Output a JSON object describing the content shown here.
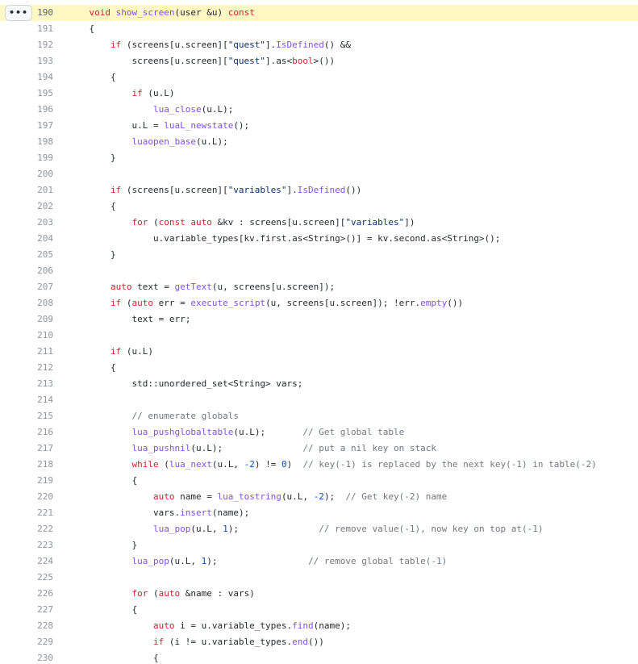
{
  "toolbar": {
    "expand_label": "•••"
  },
  "highlight_color": "#fff8c5",
  "colors": {
    "keyword": "#cf222e",
    "function": "#8250df",
    "string": "#0a3069",
    "comment": "#6e7781",
    "number": "#0550ae",
    "plain": "#24292f",
    "line_number": "#8c959f"
  },
  "lines": [
    {
      "num": "190",
      "highlighted": true,
      "tokens": [
        [
          "pl",
          "    "
        ],
        [
          "kw",
          "void"
        ],
        [
          "pl",
          " "
        ],
        [
          "fn",
          "show_screen"
        ],
        [
          "pl",
          "(user &u) "
        ],
        [
          "kw",
          "const"
        ]
      ]
    },
    {
      "num": "191",
      "tokens": [
        [
          "pl",
          "    {"
        ]
      ]
    },
    {
      "num": "192",
      "tokens": [
        [
          "pl",
          "        "
        ],
        [
          "kw",
          "if"
        ],
        [
          "pl",
          " (screens[u.screen]["
        ],
        [
          "str",
          "\"quest\""
        ],
        [
          "pl",
          "]."
        ],
        [
          "fn",
          "IsDefined"
        ],
        [
          "pl",
          "() &&"
        ]
      ]
    },
    {
      "num": "193",
      "tokens": [
        [
          "pl",
          "            screens[u.screen]["
        ],
        [
          "str",
          "\"quest\""
        ],
        [
          "pl",
          "].as<"
        ],
        [
          "kw",
          "bool"
        ],
        [
          "pl",
          ">())"
        ]
      ]
    },
    {
      "num": "194",
      "tokens": [
        [
          "pl",
          "        {"
        ]
      ]
    },
    {
      "num": "195",
      "tokens": [
        [
          "pl",
          "            "
        ],
        [
          "kw",
          "if"
        ],
        [
          "pl",
          " (u.L)"
        ]
      ]
    },
    {
      "num": "196",
      "tokens": [
        [
          "pl",
          "                "
        ],
        [
          "fn",
          "lua_close"
        ],
        [
          "pl",
          "(u.L);"
        ]
      ]
    },
    {
      "num": "197",
      "tokens": [
        [
          "pl",
          "            u.L = "
        ],
        [
          "fn",
          "luaL_newstate"
        ],
        [
          "pl",
          "();"
        ]
      ]
    },
    {
      "num": "198",
      "tokens": [
        [
          "pl",
          "            "
        ],
        [
          "fn",
          "luaopen_base"
        ],
        [
          "pl",
          "(u.L);"
        ]
      ]
    },
    {
      "num": "199",
      "tokens": [
        [
          "pl",
          "        }"
        ]
      ]
    },
    {
      "num": "200",
      "tokens": [
        [
          "pl",
          ""
        ]
      ]
    },
    {
      "num": "201",
      "tokens": [
        [
          "pl",
          "        "
        ],
        [
          "kw",
          "if"
        ],
        [
          "pl",
          " (screens[u.screen]["
        ],
        [
          "str",
          "\"variables\""
        ],
        [
          "pl",
          "]."
        ],
        [
          "fn",
          "IsDefined"
        ],
        [
          "pl",
          "())"
        ]
      ]
    },
    {
      "num": "202",
      "tokens": [
        [
          "pl",
          "        {"
        ]
      ]
    },
    {
      "num": "203",
      "tokens": [
        [
          "pl",
          "            "
        ],
        [
          "kw",
          "for"
        ],
        [
          "pl",
          " ("
        ],
        [
          "kw",
          "const"
        ],
        [
          "pl",
          " "
        ],
        [
          "kw",
          "auto"
        ],
        [
          "pl",
          " &kv : screens[u.screen]["
        ],
        [
          "str",
          "\"variables\""
        ],
        [
          "pl",
          "])"
        ]
      ]
    },
    {
      "num": "204",
      "tokens": [
        [
          "pl",
          "                u.variable_types[kv.first.as<String>()] = kv.second.as<String>();"
        ]
      ]
    },
    {
      "num": "205",
      "tokens": [
        [
          "pl",
          "        }"
        ]
      ]
    },
    {
      "num": "206",
      "tokens": [
        [
          "pl",
          ""
        ]
      ]
    },
    {
      "num": "207",
      "tokens": [
        [
          "pl",
          "        "
        ],
        [
          "kw",
          "auto"
        ],
        [
          "pl",
          " text = "
        ],
        [
          "fn",
          "getText"
        ],
        [
          "pl",
          "(u, screens[u.screen]);"
        ]
      ]
    },
    {
      "num": "208",
      "tokens": [
        [
          "pl",
          "        "
        ],
        [
          "kw",
          "if"
        ],
        [
          "pl",
          " ("
        ],
        [
          "kw",
          "auto"
        ],
        [
          "pl",
          " err = "
        ],
        [
          "fn",
          "execute_script"
        ],
        [
          "pl",
          "(u, screens[u.screen]); !err."
        ],
        [
          "fn",
          "empty"
        ],
        [
          "pl",
          "())"
        ]
      ]
    },
    {
      "num": "209",
      "tokens": [
        [
          "pl",
          "            text = err;"
        ]
      ]
    },
    {
      "num": "210",
      "tokens": [
        [
          "pl",
          ""
        ]
      ]
    },
    {
      "num": "211",
      "tokens": [
        [
          "pl",
          "        "
        ],
        [
          "kw",
          "if"
        ],
        [
          "pl",
          " (u.L)"
        ]
      ]
    },
    {
      "num": "212",
      "tokens": [
        [
          "pl",
          "        {"
        ]
      ]
    },
    {
      "num": "213",
      "tokens": [
        [
          "pl",
          "            std::unordered_set<String> vars;"
        ]
      ]
    },
    {
      "num": "214",
      "tokens": [
        [
          "pl",
          ""
        ]
      ]
    },
    {
      "num": "215",
      "tokens": [
        [
          "pl",
          "            "
        ],
        [
          "cm",
          "// enumerate globals"
        ]
      ]
    },
    {
      "num": "216",
      "tokens": [
        [
          "pl",
          "            "
        ],
        [
          "fn",
          "lua_pushglobaltable"
        ],
        [
          "pl",
          "(u.L);       "
        ],
        [
          "cm",
          "// Get global table"
        ]
      ]
    },
    {
      "num": "217",
      "tokens": [
        [
          "pl",
          "            "
        ],
        [
          "fn",
          "lua_pushnil"
        ],
        [
          "pl",
          "(u.L);               "
        ],
        [
          "cm",
          "// put a nil key on stack"
        ]
      ]
    },
    {
      "num": "218",
      "tokens": [
        [
          "pl",
          "            "
        ],
        [
          "kw",
          "while"
        ],
        [
          "pl",
          " ("
        ],
        [
          "fn",
          "lua_next"
        ],
        [
          "pl",
          "(u.L, "
        ],
        [
          "num",
          "-2"
        ],
        [
          "pl",
          ") != "
        ],
        [
          "num",
          "0"
        ],
        [
          "pl",
          ")  "
        ],
        [
          "cm",
          "// key(-1) is replaced by the next key(-1) in table(-2)"
        ]
      ]
    },
    {
      "num": "219",
      "tokens": [
        [
          "pl",
          "            {"
        ]
      ]
    },
    {
      "num": "220",
      "tokens": [
        [
          "pl",
          "                "
        ],
        [
          "kw",
          "auto"
        ],
        [
          "pl",
          " name = "
        ],
        [
          "fn",
          "lua_tostring"
        ],
        [
          "pl",
          "(u.L, "
        ],
        [
          "num",
          "-2"
        ],
        [
          "pl",
          ");  "
        ],
        [
          "cm",
          "// Get key(-2) name"
        ]
      ]
    },
    {
      "num": "221",
      "tokens": [
        [
          "pl",
          "                vars."
        ],
        [
          "fn",
          "insert"
        ],
        [
          "pl",
          "(name);"
        ]
      ]
    },
    {
      "num": "222",
      "tokens": [
        [
          "pl",
          "                "
        ],
        [
          "fn",
          "lua_pop"
        ],
        [
          "pl",
          "(u.L, "
        ],
        [
          "num",
          "1"
        ],
        [
          "pl",
          ");               "
        ],
        [
          "cm",
          "// remove value(-1), now key on top at(-1)"
        ]
      ]
    },
    {
      "num": "223",
      "tokens": [
        [
          "pl",
          "            }"
        ]
      ]
    },
    {
      "num": "224",
      "tokens": [
        [
          "pl",
          "            "
        ],
        [
          "fn",
          "lua_pop"
        ],
        [
          "pl",
          "(u.L, "
        ],
        [
          "num",
          "1"
        ],
        [
          "pl",
          ");                 "
        ],
        [
          "cm",
          "// remove global table(-1)"
        ]
      ]
    },
    {
      "num": "225",
      "tokens": [
        [
          "pl",
          ""
        ]
      ]
    },
    {
      "num": "226",
      "tokens": [
        [
          "pl",
          "            "
        ],
        [
          "kw",
          "for"
        ],
        [
          "pl",
          " ("
        ],
        [
          "kw",
          "auto"
        ],
        [
          "pl",
          " &name : vars)"
        ]
      ]
    },
    {
      "num": "227",
      "tokens": [
        [
          "pl",
          "            {"
        ]
      ]
    },
    {
      "num": "228",
      "tokens": [
        [
          "pl",
          "                "
        ],
        [
          "kw",
          "auto"
        ],
        [
          "pl",
          " i = u.variable_types."
        ],
        [
          "fn",
          "find"
        ],
        [
          "pl",
          "(name);"
        ]
      ]
    },
    {
      "num": "229",
      "tokens": [
        [
          "pl",
          "                "
        ],
        [
          "kw",
          "if"
        ],
        [
          "pl",
          " (i != u.variable_types."
        ],
        [
          "fn",
          "end"
        ],
        [
          "pl",
          "())"
        ]
      ]
    },
    {
      "num": "230",
      "tokens": [
        [
          "pl",
          "                {"
        ]
      ]
    }
  ]
}
